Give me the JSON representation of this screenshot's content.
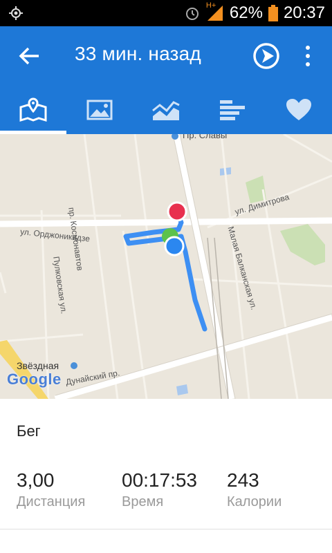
{
  "status_bar": {
    "network": "H+",
    "battery": "62%",
    "time": "20:37"
  },
  "app_bar": {
    "title": "33 мин. назад"
  },
  "tabs": [
    {
      "icon": "map-icon",
      "selected": true
    },
    {
      "icon": "photo-icon",
      "selected": false
    },
    {
      "icon": "chart-icon",
      "selected": false
    },
    {
      "icon": "splits-icon",
      "selected": false
    },
    {
      "icon": "heart-icon",
      "selected": false
    }
  ],
  "map": {
    "labels": {
      "metro_top": "Пр. Славы",
      "kosmonavtov": "пр. Космонавтов",
      "dimitrova": "ул. Димитрова",
      "ordzhonikidze": "ул. Орджоникидзе",
      "pulkovskaya": "Пулковская ул.",
      "balkanskaya": "Малая Балканская ул.",
      "zvezdnaya": "Звёздная",
      "dunaysky": "Дунайский пр."
    },
    "logo": "Google",
    "colors": {
      "route": "#3d8ff3",
      "start": "#5cc24c",
      "end": "#e8304e",
      "current": "#2b87f0"
    }
  },
  "summary": {
    "activity": "Бег",
    "stats": [
      {
        "value": "3,00",
        "label": "Дистанция"
      },
      {
        "value": "00:17:53",
        "label": "Время"
      },
      {
        "value": "243",
        "label": "Калории"
      }
    ]
  }
}
